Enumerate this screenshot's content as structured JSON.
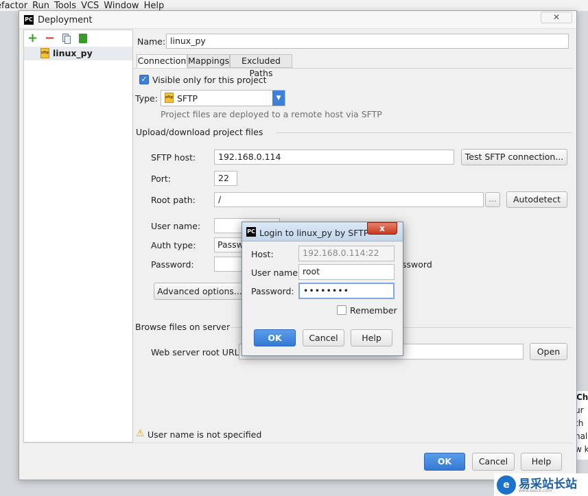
{
  "menu": [
    "efactor",
    "Run",
    "Tools",
    "VCS",
    "Window",
    "Help"
  ],
  "background_ide": {
    "title_fragment": "Ch",
    "lines": [
      "ur",
      "th",
      "nal",
      "w k"
    ]
  },
  "dialog": {
    "title": "Deployment",
    "close_glyph": "✕",
    "toolbar": {
      "add": "+",
      "remove": "−"
    },
    "server_list": [
      "linux_py"
    ],
    "file_icon_text": "sftp",
    "name_label": "Name:",
    "name_value": "linux_py",
    "tabs": [
      "Connection",
      "Mappings",
      "Excluded Paths"
    ],
    "visible_only_label": "Visible only for this project",
    "type_label": "Type:",
    "type_value": "SFTP",
    "type_hint": "Project files are deployed to a remote host via SFTP",
    "upload_section": "Upload/download project files",
    "sftp_host_label": "SFTP host:",
    "sftp_host_value": "192.168.0.114",
    "test_button": "Test SFTP connection...",
    "port_label": "Port:",
    "port_value": "22",
    "root_path_label": "Root path:",
    "root_path_value": "/",
    "browse_button": "...",
    "autodetect_button": "Autodetect",
    "user_name_label": "User name:",
    "auth_type_label": "Auth type:",
    "auth_type_value": "Passwo",
    "password_label": "Password:",
    "save_password_fragment": "ssword",
    "advanced_button": "Advanced options...",
    "browse_section": "Browse files on server",
    "web_root_label": "Web server root URL:",
    "open_button": "Open",
    "warning_icon": "⚠",
    "warning": "User name is not specified",
    "ok": "OK",
    "cancel": "Cancel",
    "help": "Help"
  },
  "login": {
    "title": "Login to linux_py by SFTP",
    "close_glyph": "x",
    "host_label": "Host:",
    "host_value": "192.168.0.114:22",
    "user_label": "User name:",
    "user_value": "root",
    "password_label": "Password:",
    "password_value": "••••••••",
    "remember_label": "Remember",
    "ok": "OK",
    "cancel": "Cancel",
    "help": "Help"
  },
  "watermark": {
    "logo_letter": "e",
    "text": "易采站长站",
    "subtext": "www.easck.com"
  },
  "colors": {
    "primary_button": "#3579d6",
    "selection": "#e7eaee",
    "warning": "#e8a317"
  }
}
